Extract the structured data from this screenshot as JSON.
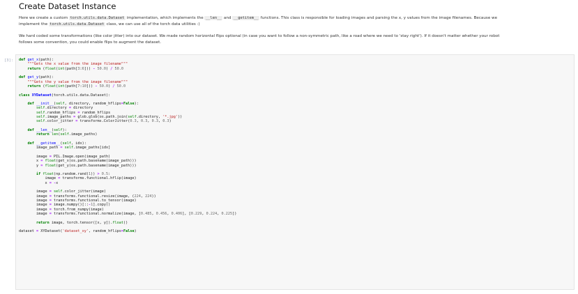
{
  "heading": "Create Dataset Instance",
  "para1": {
    "t1": "Here we create a custom ",
    "c1": "torch.utils.data.Dataset",
    "t2": " implementation, which implements the ",
    "c2": "__len__",
    "t3": " and ",
    "c3": "__getitem__",
    "t4": " functions. This class is responsible for loading images and parsing the x, y values from the image filenames. Because we",
    "t5": "implement the ",
    "c4": "torch.utils.data.Dataset",
    "t6": " class, we can use all of the torch data utilities :)"
  },
  "para2": {
    "line1": "We hard coded some transformations (like color jitter) into our dataset. We made random horizontal flips optional (in case you want to follow a non-symmetric path, like a road where we need to 'stay right'). If it doesn't matter whether your robot",
    "line2": "follows some convention, you could enable flips to augment the dataset."
  },
  "cell": {
    "prompt": "[3]:",
    "code": "def get_x(path):\n    \"\"\"Gets the x value from the image filename\"\"\"\n    return (float(int(path[3:6])) - 50.0) / 50.0\n\ndef get_y(path):\n    \"\"\"Gets the y value from the image filename\"\"\"\n    return (float(int(path[7:10])) - 50.0) / 50.0\n\nclass XYDataset(torch.utils.data.Dataset):\n\n    def __init__(self, directory, random_hflips=False):\n        self.directory = directory\n        self.random_hflips = random_hflips\n        self.image_paths = glob.glob(os.path.join(self.directory, '*.jpg'))\n        self.color_jitter = transforms.ColorJitter(0.3, 0.3, 0.3, 0.3)\n\n    def __len__(self):\n        return len(self.image_paths)\n\n    def __getitem__(self, idx):\n        image_path = self.image_paths[idx]\n\n        image = PIL.Image.open(image_path)\n        x = float(get_x(os.path.basename(image_path)))\n        y = float(get_y(os.path.basename(image_path)))\n\n        if float(np.random.rand(1)) > 0.5:\n            image = transforms.functional.hflip(image)\n            x = -x\n\n        image = self.color_jitter(image)\n        image = transforms.functional.resize(image, (224, 224))\n        image = transforms.functional.to_tensor(image)\n        image = image.numpy()[::-1].copy()\n        image = torch.from_numpy(image)\n        image = transforms.functional.normalize(image, [0.485, 0.456, 0.406], [0.229, 0.224, 0.225])\n\n        return image, torch.tensor([x, y]).float()\n\ndataset = XYDataset('dataset_xy', random_hflips=False)"
  }
}
